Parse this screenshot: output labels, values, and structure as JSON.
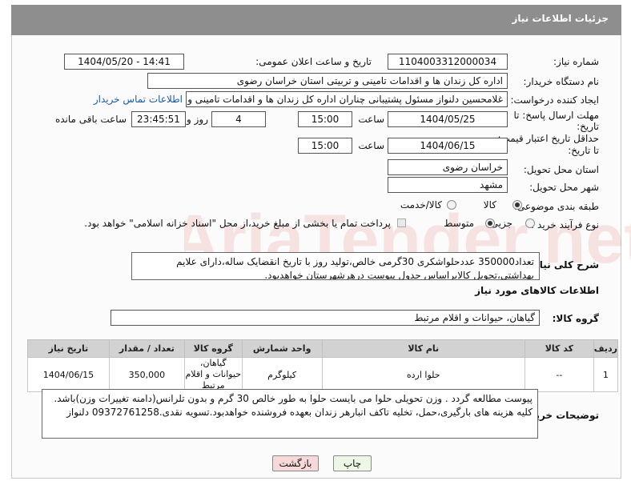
{
  "header": {
    "title": "جزئیات اطلاعات نیاز"
  },
  "fields": {
    "need_number_label": "شماره نیاز:",
    "need_number_value": "1104003312000034",
    "announce_label": "تاریخ و ساعت اعلان عمومی:",
    "announce_value": "1404/05/20 - 14:41",
    "buyer_label": "نام دستگاه خریدار:",
    "buyer_value": "اداره کل زندان ها و اقدامات تامینی و تربیتی استان خراسان رضوی",
    "creator_label": "ایجاد کننده درخواست:",
    "creator_value": "غلامحسین دلنواز مسئول پشتیبانی چناران اداره کل زندان ها و اقدامات تامینی و",
    "contact_link": "اطلاعات تماس خریدار",
    "deadline_label_1": "مهلت ارسال پاسخ: تا",
    "deadline_label_2": "تاریخ:",
    "deadline_date": "1404/05/25",
    "time_label": "ساعت",
    "deadline_time": "15:00",
    "days_value": "4",
    "days_label": "روز و",
    "remaining_value": "23:45:51",
    "remaining_label": "ساعت باقی مانده",
    "validity_label_1": "حداقل تاریخ اعتبار قیمت:",
    "validity_label_2": "تا تاریخ:",
    "validity_date": "1404/06/15",
    "validity_time": "15:00",
    "province_label": "استان محل تحویل:",
    "province_value": "خراسان رضوی",
    "city_label": "شهر محل تحویل:",
    "city_value": "مشهد",
    "category_label": "طبقه بندی موضوعی:",
    "category_options": [
      "کالا",
      "کالا/خدمت"
    ],
    "process_label": "نوع فرآیند خرید :",
    "process_options": [
      "جزیی",
      "متوسط"
    ],
    "payment_note": "پرداخت تمام یا بخشی از مبلغ خرید،از محل \"اسناد خزانه اسلامی\" خواهد بود."
  },
  "description": {
    "label": "شرح کلی نیاز:",
    "text": "تعداد350000 عددحلواشکری 30گرمی خالص،تولید روز با تاریخ انقضایک ساله،دارای علایم بهداشتی،تحویل کالابراساس جدول پیوست درهرشهرستان خواهدبود."
  },
  "goods_section": {
    "title": "اطلاعات کالاهای مورد نیاز",
    "group_label": "گروه کالا:",
    "group_value": "گیاهان، حیوانات و اقلام مرتبط"
  },
  "table": {
    "headers": [
      "ردیف",
      "کد کالا",
      "نام کالا",
      "واحد شمارش",
      "گروه کالا",
      "تعداد / مقدار",
      "تاریخ نیاز"
    ],
    "rows": [
      [
        "1",
        "--",
        "حلوا ارده",
        "کیلوگرم",
        "گیاهان، حیوانات و اقلام مرتبط",
        "350,000",
        "1404/06/15"
      ]
    ]
  },
  "buyer_notes": {
    "label": "توضیحات خریدار:",
    "text": "پیوست مطالعه گردد . وزن تحویلی حلوا می بایست حلوا به طور خالص 30 گرم و بدون تلرانس(دامنه تغییرات وزن)باشد. کلیه هزینه های بارگیری،حمل، تخلیه تاکف انبارهر زندان بعهده فروشنده خواهدبود.تسویه نقدی.09372761258 دلنواز"
  },
  "buttons": {
    "print": "چاپ",
    "back": "بازگشت"
  },
  "watermark": {
    "text": "AriaTender.net"
  },
  "colors": {
    "header_bg": "#8e8e8e",
    "link": "#1a5aa6",
    "back_button_bg": "#f7d9d9",
    "print_button_bg": "#eef6e6"
  }
}
